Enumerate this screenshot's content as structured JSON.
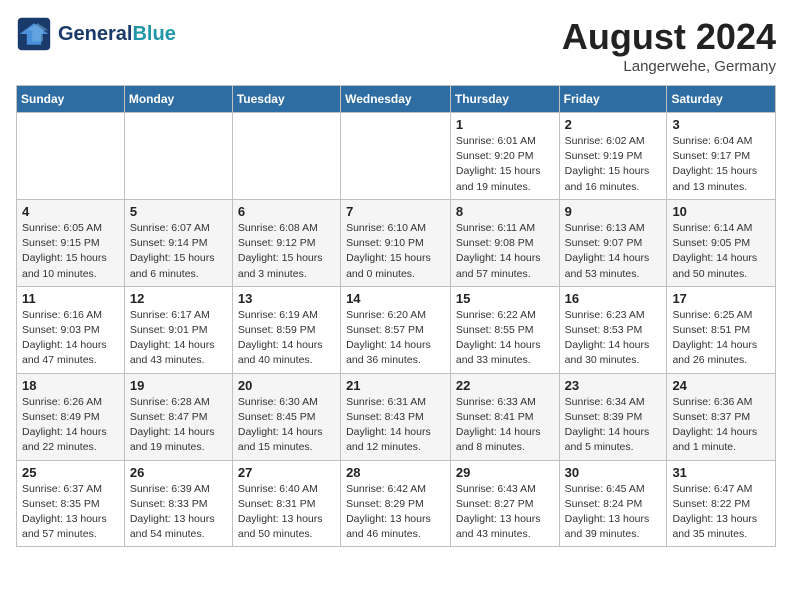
{
  "header": {
    "logo_line1": "General",
    "logo_line2": "Blue",
    "month": "August 2024",
    "location": "Langerwehe, Germany"
  },
  "weekdays": [
    "Sunday",
    "Monday",
    "Tuesday",
    "Wednesday",
    "Thursday",
    "Friday",
    "Saturday"
  ],
  "weeks": [
    [
      {
        "day": "",
        "info": ""
      },
      {
        "day": "",
        "info": ""
      },
      {
        "day": "",
        "info": ""
      },
      {
        "day": "",
        "info": ""
      },
      {
        "day": "1",
        "info": "Sunrise: 6:01 AM\nSunset: 9:20 PM\nDaylight: 15 hours\nand 19 minutes."
      },
      {
        "day": "2",
        "info": "Sunrise: 6:02 AM\nSunset: 9:19 PM\nDaylight: 15 hours\nand 16 minutes."
      },
      {
        "day": "3",
        "info": "Sunrise: 6:04 AM\nSunset: 9:17 PM\nDaylight: 15 hours\nand 13 minutes."
      }
    ],
    [
      {
        "day": "4",
        "info": "Sunrise: 6:05 AM\nSunset: 9:15 PM\nDaylight: 15 hours\nand 10 minutes."
      },
      {
        "day": "5",
        "info": "Sunrise: 6:07 AM\nSunset: 9:14 PM\nDaylight: 15 hours\nand 6 minutes."
      },
      {
        "day": "6",
        "info": "Sunrise: 6:08 AM\nSunset: 9:12 PM\nDaylight: 15 hours\nand 3 minutes."
      },
      {
        "day": "7",
        "info": "Sunrise: 6:10 AM\nSunset: 9:10 PM\nDaylight: 15 hours\nand 0 minutes."
      },
      {
        "day": "8",
        "info": "Sunrise: 6:11 AM\nSunset: 9:08 PM\nDaylight: 14 hours\nand 57 minutes."
      },
      {
        "day": "9",
        "info": "Sunrise: 6:13 AM\nSunset: 9:07 PM\nDaylight: 14 hours\nand 53 minutes."
      },
      {
        "day": "10",
        "info": "Sunrise: 6:14 AM\nSunset: 9:05 PM\nDaylight: 14 hours\nand 50 minutes."
      }
    ],
    [
      {
        "day": "11",
        "info": "Sunrise: 6:16 AM\nSunset: 9:03 PM\nDaylight: 14 hours\nand 47 minutes."
      },
      {
        "day": "12",
        "info": "Sunrise: 6:17 AM\nSunset: 9:01 PM\nDaylight: 14 hours\nand 43 minutes."
      },
      {
        "day": "13",
        "info": "Sunrise: 6:19 AM\nSunset: 8:59 PM\nDaylight: 14 hours\nand 40 minutes."
      },
      {
        "day": "14",
        "info": "Sunrise: 6:20 AM\nSunset: 8:57 PM\nDaylight: 14 hours\nand 36 minutes."
      },
      {
        "day": "15",
        "info": "Sunrise: 6:22 AM\nSunset: 8:55 PM\nDaylight: 14 hours\nand 33 minutes."
      },
      {
        "day": "16",
        "info": "Sunrise: 6:23 AM\nSunset: 8:53 PM\nDaylight: 14 hours\nand 30 minutes."
      },
      {
        "day": "17",
        "info": "Sunrise: 6:25 AM\nSunset: 8:51 PM\nDaylight: 14 hours\nand 26 minutes."
      }
    ],
    [
      {
        "day": "18",
        "info": "Sunrise: 6:26 AM\nSunset: 8:49 PM\nDaylight: 14 hours\nand 22 minutes."
      },
      {
        "day": "19",
        "info": "Sunrise: 6:28 AM\nSunset: 8:47 PM\nDaylight: 14 hours\nand 19 minutes."
      },
      {
        "day": "20",
        "info": "Sunrise: 6:30 AM\nSunset: 8:45 PM\nDaylight: 14 hours\nand 15 minutes."
      },
      {
        "day": "21",
        "info": "Sunrise: 6:31 AM\nSunset: 8:43 PM\nDaylight: 14 hours\nand 12 minutes."
      },
      {
        "day": "22",
        "info": "Sunrise: 6:33 AM\nSunset: 8:41 PM\nDaylight: 14 hours\nand 8 minutes."
      },
      {
        "day": "23",
        "info": "Sunrise: 6:34 AM\nSunset: 8:39 PM\nDaylight: 14 hours\nand 5 minutes."
      },
      {
        "day": "24",
        "info": "Sunrise: 6:36 AM\nSunset: 8:37 PM\nDaylight: 14 hours\nand 1 minute."
      }
    ],
    [
      {
        "day": "25",
        "info": "Sunrise: 6:37 AM\nSunset: 8:35 PM\nDaylight: 13 hours\nand 57 minutes."
      },
      {
        "day": "26",
        "info": "Sunrise: 6:39 AM\nSunset: 8:33 PM\nDaylight: 13 hours\nand 54 minutes."
      },
      {
        "day": "27",
        "info": "Sunrise: 6:40 AM\nSunset: 8:31 PM\nDaylight: 13 hours\nand 50 minutes."
      },
      {
        "day": "28",
        "info": "Sunrise: 6:42 AM\nSunset: 8:29 PM\nDaylight: 13 hours\nand 46 minutes."
      },
      {
        "day": "29",
        "info": "Sunrise: 6:43 AM\nSunset: 8:27 PM\nDaylight: 13 hours\nand 43 minutes."
      },
      {
        "day": "30",
        "info": "Sunrise: 6:45 AM\nSunset: 8:24 PM\nDaylight: 13 hours\nand 39 minutes."
      },
      {
        "day": "31",
        "info": "Sunrise: 6:47 AM\nSunset: 8:22 PM\nDaylight: 13 hours\nand 35 minutes."
      }
    ]
  ]
}
